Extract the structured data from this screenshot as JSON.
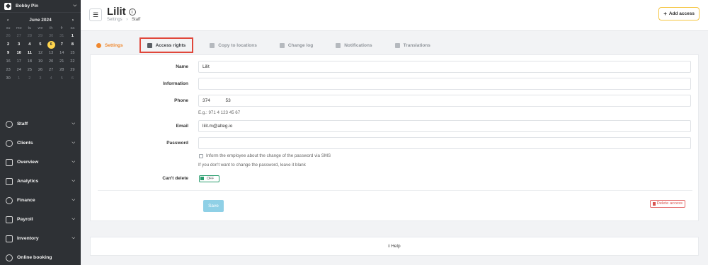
{
  "sidebar": {
    "company": "Bobby Pin",
    "calendar": {
      "month": "June 2024",
      "weekdays": [
        "su",
        "mo",
        "tu",
        "we",
        "th",
        "fr",
        "sa"
      ],
      "weeks": [
        [
          "26",
          "27",
          "28",
          "29",
          "30",
          "31",
          "1"
        ],
        [
          "2",
          "3",
          "4",
          "5",
          "6",
          "7",
          "8"
        ],
        [
          "9",
          "10",
          "11",
          "12",
          "13",
          "14",
          "15"
        ],
        [
          "16",
          "17",
          "18",
          "19",
          "20",
          "21",
          "22"
        ],
        [
          "23",
          "24",
          "25",
          "26",
          "27",
          "28",
          "29"
        ],
        [
          "30",
          "1",
          "2",
          "3",
          "4",
          "5",
          "6"
        ]
      ],
      "selected_day": "6"
    },
    "menu": [
      {
        "label": "Staff",
        "icon": "person-icon"
      },
      {
        "label": "Clients",
        "icon": "clients-icon"
      },
      {
        "label": "Overview",
        "icon": "grid-icon"
      },
      {
        "label": "Analytics",
        "icon": "chart-icon"
      },
      {
        "label": "Finance",
        "icon": "finance-icon"
      },
      {
        "label": "Payroll",
        "icon": "payroll-icon"
      },
      {
        "label": "Inventory",
        "icon": "inventory-icon"
      },
      {
        "label": "Online booking",
        "icon": "globe-icon"
      }
    ]
  },
  "header": {
    "title": "Lilit",
    "breadcrumb": [
      "Settings",
      "Staff"
    ],
    "add_access_label": "Add access"
  },
  "tabs": [
    {
      "label": "Settings",
      "icon": "person-icon",
      "state": "active"
    },
    {
      "label": "Access rights",
      "icon": "gears-icon",
      "state": "highlighted"
    },
    {
      "label": "Copy to locations",
      "icon": "copy-icon",
      "state": "normal"
    },
    {
      "label": "Change log",
      "icon": "edit-icon",
      "state": "normal"
    },
    {
      "label": "Notifications",
      "icon": "bell-icon",
      "state": "normal"
    },
    {
      "label": "Translations",
      "icon": "translate-icon",
      "state": "normal"
    }
  ],
  "form": {
    "name_label": "Name",
    "name_value": "Lilit",
    "information_label": "Information",
    "information_value": "",
    "phone_label": "Phone",
    "phone_value": "374            53",
    "phone_hint": "E.g.: 971 4 123 45 67",
    "email_label": "Email",
    "email_value": "lilit.m@alteg.io",
    "password_label": "Password",
    "password_value": "",
    "inform_checkbox_label": "Inform the employee about the change of the password via SMS",
    "password_hint": "If you don't want to change the password, leave it blank",
    "cant_delete_label": "Can't delete",
    "cant_delete_toggle": "OFF",
    "save_label": "Save",
    "delete_label": "Delete access"
  },
  "help": {
    "icon": "info-icon",
    "label": "Help"
  }
}
